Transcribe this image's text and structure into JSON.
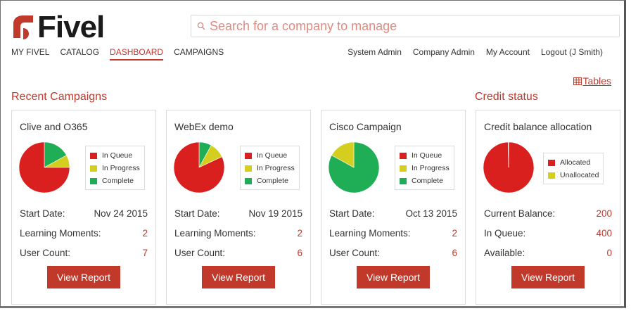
{
  "brand": {
    "name": "Fivel"
  },
  "search": {
    "placeholder": "Search for a company to manage",
    "value": ""
  },
  "nav_left": [
    "MY FIVEL",
    "CATALOG",
    "DASHBOARD",
    "CAMPAIGNS"
  ],
  "nav_active": "DASHBOARD",
  "nav_right": [
    "System Admin",
    "Company Admin",
    "My Account",
    "Logout (J Smith)"
  ],
  "tables_label": "Tables",
  "sections": {
    "recent_campaigns": "Recent Campaigns",
    "credit_status": "Credit status"
  },
  "colors": {
    "accent": "#c0392b",
    "in_queue": "#d9201f",
    "in_progress": "#d4cf1f",
    "complete": "#1fae55",
    "allocated": "#d9201f",
    "unallocated": "#d4cf1f"
  },
  "campaign_legend": [
    "In Queue",
    "In Progress",
    "Complete"
  ],
  "campaign_labels": {
    "start_date": "Start Date:",
    "learning_moments": "Learning Moments:",
    "user_count": "User Count:"
  },
  "view_report": "View Report",
  "campaigns": [
    {
      "title": "Clive and O365",
      "start_date": "Nov 24 2015",
      "learning_moments": "2",
      "user_count": "7",
      "pie": {
        "in_queue": 0.75,
        "in_progress": 0.08,
        "complete": 0.17
      }
    },
    {
      "title": "WebEx demo",
      "start_date": "Nov 19 2015",
      "learning_moments": "2",
      "user_count": "6",
      "pie": {
        "in_queue": 0.82,
        "in_progress": 0.1,
        "complete": 0.08
      }
    },
    {
      "title": "Cisco Campaign",
      "start_date": "Oct 13 2015",
      "learning_moments": "2",
      "user_count": "6",
      "pie": {
        "in_queue": 0.0,
        "in_progress": 0.17,
        "complete": 0.83
      }
    }
  ],
  "credit": {
    "title": "Credit balance allocation",
    "legend": [
      "Allocated",
      "Unallocated"
    ],
    "pie": {
      "allocated": 0.997,
      "unallocated": 0.003
    },
    "labels": {
      "current_balance": "Current Balance:",
      "in_queue": "In Queue:",
      "available": "Available:"
    },
    "current_balance": "200",
    "in_queue": "400",
    "available": "0"
  }
}
